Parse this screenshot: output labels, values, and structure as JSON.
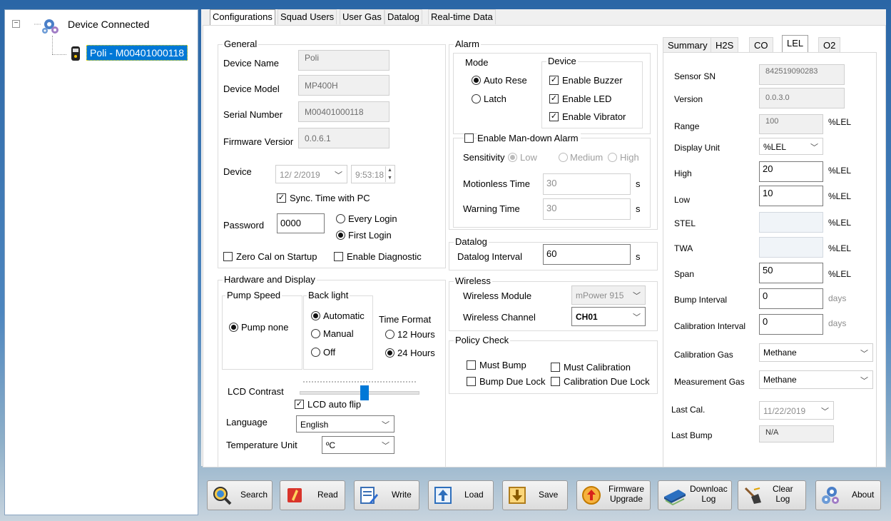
{
  "tree": {
    "root_label": "Device Connected",
    "child_label": "Poli - M00401000118",
    "expander": "−"
  },
  "tabs": [
    "Configurations",
    "Squad Users",
    "User Gas",
    "Datalog",
    "Real-time Data"
  ],
  "general": {
    "title": "General",
    "device_name_label": "Device Name",
    "device_name": "Poli",
    "device_model_label": "Device Model",
    "device_model": "MP400H",
    "serial_label": "Serial Number",
    "serial": "M00401000118",
    "firmware_label": "Firmware Versior",
    "firmware": "0.0.6.1",
    "device_label": "Device",
    "device_date": "12/ 2/2019",
    "device_time": "9:53:18",
    "sync_label": "Sync. Time with PC",
    "password_label": "Password",
    "password": "0000",
    "every_login": "Every Login",
    "first_login": "First Login",
    "zero_cal": "Zero Cal on Startup",
    "enable_diag": "Enable Diagnostic"
  },
  "hardware": {
    "title": "Hardware and Display",
    "pump_speed_title": "Pump Speed",
    "pump_none": "Pump none",
    "backlight_title": "Back light",
    "automatic": "Automatic",
    "manual": "Manual",
    "off": "Off",
    "time_format_label": "Time Format",
    "h12": "12 Hours",
    "h24": "24 Hours",
    "lcd_contrast": "LCD Contrast",
    "lcd_contrast_value": 0.55,
    "lcd_auto_flip": "LCD auto flip",
    "language_label": "Language",
    "language": "English",
    "temp_unit_label": "Temperature Unit",
    "temp_unit": "ºC"
  },
  "alarm": {
    "title": "Alarm",
    "mode_title": "Mode",
    "auto_reset": "Auto Rese",
    "latch": "Latch",
    "device_title": "Device",
    "enable_buzzer": "Enable Buzzer",
    "enable_led": "Enable LED",
    "enable_vibrator": "Enable Vibrator",
    "mandown_label": "Enable Man-down Alarm",
    "sensitivity_label": "Sensitivity",
    "low": "Low",
    "medium": "Medium",
    "high": "High",
    "motionless_label": "Motionless Time",
    "motionless": "30",
    "warning_label": "Warning Time",
    "warning": "30",
    "unit_s": "s"
  },
  "datalog": {
    "title": "Datalog",
    "interval_label": "Datalog Interval",
    "interval": "60",
    "unit": "s"
  },
  "wireless": {
    "title": "Wireless",
    "module_label": "Wireless Module",
    "module": "mPower 915",
    "channel_label": "Wireless Channel",
    "channel": "CH01"
  },
  "policy": {
    "title": "Policy Check",
    "must_bump": "Must Bump",
    "must_cal": "Must Calibration",
    "bump_lock": "Bump Due Lock",
    "cal_lock": "Calibration Due Lock"
  },
  "sensor_tabs": [
    "Summary",
    "H2S",
    "CO",
    "LEL",
    "O2"
  ],
  "sensor": {
    "sn_label": "Sensor SN",
    "sn": "842519090283",
    "version_label": "Version",
    "version": "0.0.3.0",
    "range_label": "Range",
    "range": "100",
    "unit": "%LEL",
    "display_unit_label": "Display Unit",
    "display_unit": "%LEL",
    "high_label": "High",
    "high": "20",
    "low_label": "Low",
    "low": "10",
    "stel_label": "STEL",
    "twa_label": "TWA",
    "span_label": "Span",
    "span": "50",
    "bump_interval_label": "Bump Interval",
    "bump_interval": "0",
    "cal_interval_label": "Calibration Interval",
    "cal_interval": "0",
    "days": "days",
    "cal_gas_label": "Calibration Gas",
    "cal_gas": "Methane",
    "meas_gas_label": "Measurement Gas",
    "meas_gas": "Methane",
    "last_cal_label": "Last Cal.",
    "last_cal": "11/22/2019",
    "last_bump_label": "Last Bump",
    "last_bump": "N/A"
  },
  "toolbar": {
    "search": "Search",
    "read": "Read",
    "write": "Write",
    "load": "Load",
    "save": "Save",
    "firmware_1": "Firmware",
    "firmware_2": "Upgrade",
    "download_1": "Downloac",
    "download_2": "Log",
    "clear_1": "Clear",
    "clear_2": "Log",
    "about": "About"
  },
  "colors": {
    "selection": "#0078d7",
    "accent_blue": "#0078d7"
  }
}
